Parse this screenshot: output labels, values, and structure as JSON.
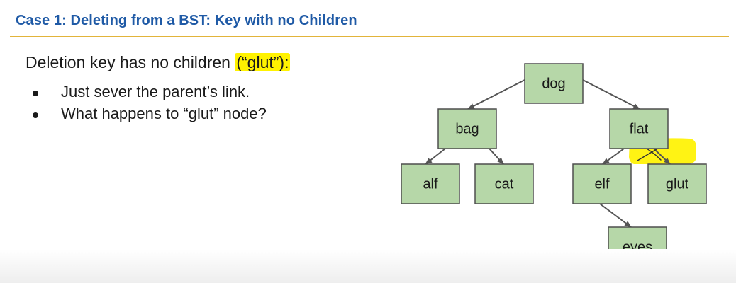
{
  "slide": {
    "title": "Case 1: Deleting from a BST: Key with no Children",
    "intro_before": "Deletion key has no children ",
    "intro_highlight": "(“glut”):",
    "bullets": [
      "Just sever the parent’s link.",
      "What happens to “glut” node?"
    ]
  },
  "tree": {
    "nodes": [
      {
        "id": "dog",
        "label": "dog"
      },
      {
        "id": "bag",
        "label": "bag"
      },
      {
        "id": "flat",
        "label": "flat"
      },
      {
        "id": "alf",
        "label": "alf"
      },
      {
        "id": "cat",
        "label": "cat"
      },
      {
        "id": "elf",
        "label": "elf"
      },
      {
        "id": "glut",
        "label": "glut"
      },
      {
        "id": "eyes",
        "label": "eyes"
      }
    ],
    "edges": [
      {
        "from": "dog",
        "to": "bag"
      },
      {
        "from": "dog",
        "to": "flat"
      },
      {
        "from": "bag",
        "to": "alf"
      },
      {
        "from": "bag",
        "to": "cat"
      },
      {
        "from": "flat",
        "to": "elf"
      },
      {
        "from": "flat",
        "to": "glut",
        "severed": true
      },
      {
        "from": "elf",
        "to": "eyes"
      }
    ]
  },
  "colors": {
    "title": "#1f5aa6",
    "rule": "#e2b43a",
    "node_fill": "#b6d7a8",
    "node_stroke": "#4e4e4e",
    "highlight": "#fff200"
  }
}
